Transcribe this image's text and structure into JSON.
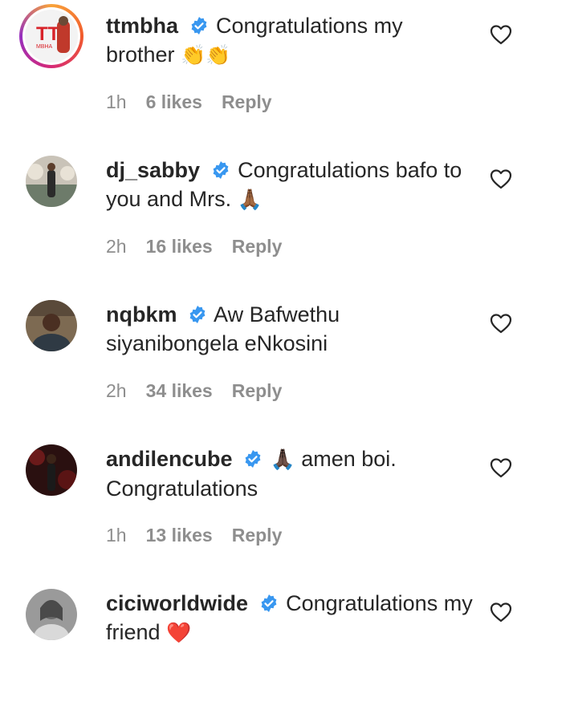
{
  "comments": [
    {
      "username": "ttmbha",
      "text": "Congratulations my brother",
      "emoji": "👏👏",
      "time": "1h",
      "likes": "6 likes",
      "reply": "Reply",
      "verified": true,
      "avatar_text": "TT",
      "avatar_subtext": "MBHA"
    },
    {
      "username": "dj_sabby",
      "text": "Congratulations bafo to you and Mrs.",
      "emoji": "🙏🏾",
      "time": "2h",
      "likes": "16 likes",
      "reply": "Reply",
      "verified": true
    },
    {
      "username": "nqbkm",
      "text": "Aw Bafwethu siyanibongela eNkosini",
      "emoji": "",
      "time": "2h",
      "likes": "34 likes",
      "reply": "Reply",
      "verified": true
    },
    {
      "username": "andilencube",
      "text_before": "",
      "emoji": "🙏🏿",
      "text": "amen boi. Congratulations",
      "time": "1h",
      "likes": "13 likes",
      "reply": "Reply",
      "verified": true
    },
    {
      "username": "ciciworldwide",
      "text": "Congratulations my friend",
      "emoji": "❤️",
      "verified": true
    }
  ],
  "colors": {
    "verified_blue": "#3897f0",
    "meta_gray": "#8e8e8e",
    "text": "#262626",
    "heart_red": "#e0245e"
  }
}
